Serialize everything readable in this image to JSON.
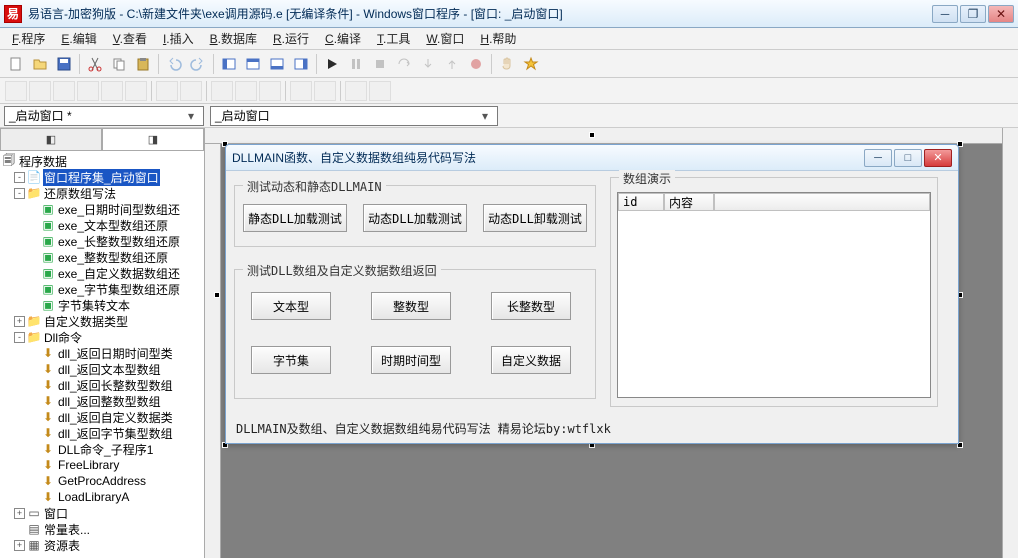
{
  "app": {
    "logo_char": "易",
    "title": "易语言-加密狗版 - C:\\新建文件夹\\exe调用源码.e [无编译条件] - Windows窗口程序 - [窗口: _启动窗口]"
  },
  "menu": {
    "items": [
      {
        "ul": "F",
        "rest": ".程序"
      },
      {
        "ul": "E",
        "rest": ".编辑"
      },
      {
        "ul": "V",
        "rest": ".查看"
      },
      {
        "ul": "I",
        "rest": ".插入"
      },
      {
        "ul": "B",
        "rest": ".数据库"
      },
      {
        "ul": "R",
        "rest": ".运行"
      },
      {
        "ul": "C",
        "rest": ".编译"
      },
      {
        "ul": "T",
        "rest": ".工具"
      },
      {
        "ul": "W",
        "rest": ".窗口"
      },
      {
        "ul": "H",
        "rest": ".帮助"
      }
    ]
  },
  "combo": {
    "c1": "_启动窗口 *",
    "c2": "_启动窗口"
  },
  "tree": {
    "root": "程序数据",
    "items": [
      {
        "level": 1,
        "exp": "-",
        "ico": "pkg",
        "text": "窗口程序集_启动窗口",
        "sel": true
      },
      {
        "level": 1,
        "exp": "-",
        "ico": "fld",
        "text": "还原数组写法"
      },
      {
        "level": 2,
        "exp": "",
        "ico": "sub",
        "text": "exe_日期时间型数组还"
      },
      {
        "level": 2,
        "exp": "",
        "ico": "sub",
        "text": "exe_文本型数组还原"
      },
      {
        "level": 2,
        "exp": "",
        "ico": "sub",
        "text": "exe_长整数型数组还原"
      },
      {
        "level": 2,
        "exp": "",
        "ico": "sub",
        "text": "exe_整数型数组还原"
      },
      {
        "level": 2,
        "exp": "",
        "ico": "sub",
        "text": "exe_自定义数据数组还"
      },
      {
        "level": 2,
        "exp": "",
        "ico": "sub",
        "text": "exe_字节集型数组还原"
      },
      {
        "level": 2,
        "exp": "",
        "ico": "sub",
        "text": "字节集转文本"
      },
      {
        "level": 1,
        "exp": "+",
        "ico": "fld",
        "text": "自定义数据类型"
      },
      {
        "level": 1,
        "exp": "-",
        "ico": "fld",
        "text": "Dll命令"
      },
      {
        "level": 2,
        "exp": "",
        "ico": "dll",
        "text": "dll_返回日期时间型类"
      },
      {
        "level": 2,
        "exp": "",
        "ico": "dll",
        "text": "dll_返回文本型数组"
      },
      {
        "level": 2,
        "exp": "",
        "ico": "dll",
        "text": "dll_返回长整数型数组"
      },
      {
        "level": 2,
        "exp": "",
        "ico": "dll",
        "text": "dll_返回整数型数组"
      },
      {
        "level": 2,
        "exp": "",
        "ico": "dll",
        "text": "dll_返回自定义数据类"
      },
      {
        "level": 2,
        "exp": "",
        "ico": "dll",
        "text": "dll_返回字节集型数组"
      },
      {
        "level": 2,
        "exp": "",
        "ico": "dll",
        "text": "DLL命令_子程序1"
      },
      {
        "level": 2,
        "exp": "",
        "ico": "dll",
        "text": "FreeLibrary"
      },
      {
        "level": 2,
        "exp": "",
        "ico": "dll",
        "text": "GetProcAddress"
      },
      {
        "level": 2,
        "exp": "",
        "ico": "dll",
        "text": "LoadLibraryA"
      },
      {
        "level": 1,
        "exp": "+",
        "ico": "win",
        "text": "窗口"
      },
      {
        "level": 1,
        "exp": "",
        "ico": "tbl",
        "text": "常量表..."
      },
      {
        "level": 1,
        "exp": "+",
        "ico": "res",
        "text": "资源表"
      }
    ]
  },
  "dlg": {
    "title": "DLLMAIN函数、自定义数据数组纯易代码写法",
    "group1": {
      "title": "测试动态和静态DLLMAIN",
      "btn1": "静态DLL加载测试",
      "btn2": "动态DLL加载测试",
      "btn3": "动态DLL卸载测试"
    },
    "group2": {
      "title": "测试DLL数组及自定义数据数组返回",
      "btn1": "文本型",
      "btn2": "整数型",
      "btn3": "长整数型",
      "btn4": "字节集",
      "btn5": "时期时间型",
      "btn6": "自定义数据"
    },
    "group3": {
      "title": "数组演示",
      "col1": "id",
      "col2": "内容"
    },
    "footer": "DLLMAIN及数组、自定义数据数组纯易代码写法 精易论坛by:wtflxk"
  }
}
